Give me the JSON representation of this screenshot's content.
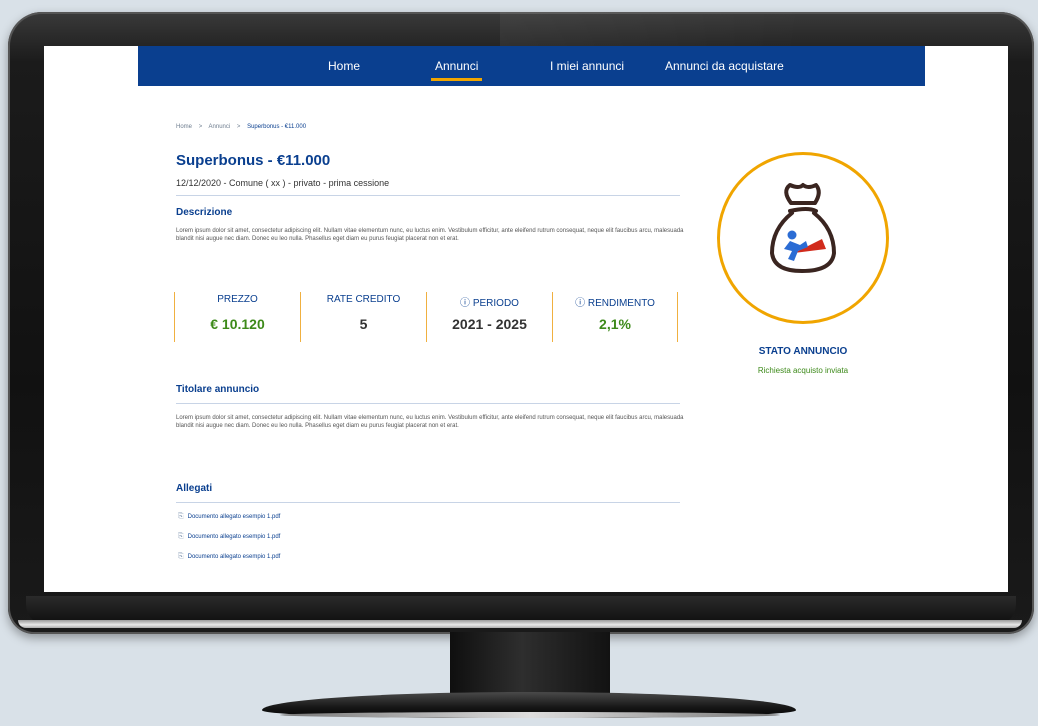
{
  "nav": {
    "items": [
      {
        "label": "Home",
        "active": false
      },
      {
        "label": "Annunci",
        "active": true
      },
      {
        "label": "I miei annunci",
        "active": false
      },
      {
        "label": "Annunci da acquistare",
        "active": false
      }
    ]
  },
  "breadcrumb": {
    "items": [
      "Home",
      "Annunci",
      "Superbonus - €11.000"
    ]
  },
  "listing": {
    "title": "Superbonus - €11.000",
    "subtitle": "12/12/2020 - Comune ( xx ) - privato - prima cessione"
  },
  "description": {
    "heading": "Descrizione",
    "text": "Lorem ipsum dolor sit amet, consectetur adipiscing elit. Nullam vitae elementum nunc, eu luctus enim. Vestibulum efficitur, ante eleifend rutrum consequat, neque elit faucibus arcu, malesuada blandit nisi augue nec diam. Donec eu leo nulla. Phasellus eget diam eu purus feugiat placerat non et erat."
  },
  "stats": [
    {
      "label": "PREZZO",
      "value": "€ 10.120",
      "value_color": "#3d8a1a"
    },
    {
      "label": "RATE CREDITO",
      "value": "5",
      "value_color": "#333333"
    },
    {
      "label": "ⓘ PERIODO",
      "value": "2021 - 2025",
      "value_color": "#333333"
    },
    {
      "label": "ⓘ RENDIMENTO",
      "value": "2,1%",
      "value_color": "#3d8a1a"
    }
  ],
  "owner": {
    "heading": "Titolare annuncio",
    "text": "Lorem ipsum dolor sit amet, consectetur adipiscing elit. Nullam vitae elementum nunc, eu luctus enim. Vestibulum efficitur, ante eleifend rutrum consequat, neque elit faucibus arcu, malesuada blandit nisi augue nec diam. Donec eu leo nulla. Phasellus eget diam eu purus feugiat placerat non et erat."
  },
  "attachments": {
    "heading": "Allegati",
    "items": [
      "Documento allegato esempio 1.pdf",
      "Documento allegato esempio 1.pdf",
      "Documento allegato esempio 1.pdf"
    ]
  },
  "status": {
    "icon": "money-bag-superhero-icon",
    "label": "STATO ANNUNCIO",
    "value": "Richiesta acquisto inviata"
  },
  "colors": {
    "brand_blue": "#0a3f8f",
    "accent_orange": "#f0a500",
    "success_green": "#3d8a1a"
  }
}
